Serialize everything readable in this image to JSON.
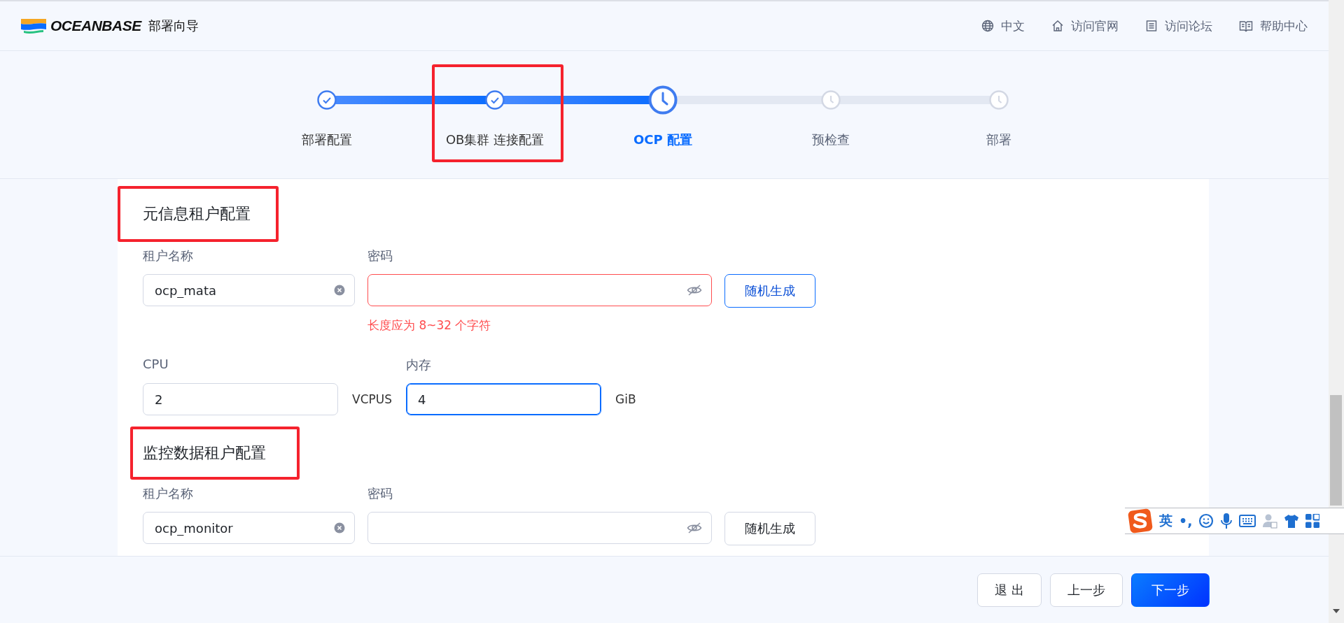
{
  "header": {
    "logo": "OCEANBASE",
    "title": "部署向导",
    "links": [
      {
        "label": "中文"
      },
      {
        "label": "访问官网"
      },
      {
        "label": "访问论坛"
      },
      {
        "label": "帮助中心"
      }
    ]
  },
  "steps": [
    {
      "label": "部署配置",
      "completed": true,
      "active": false,
      "highlighted": false
    },
    {
      "label": "OB集群 连接配置",
      "completed": true,
      "active": false,
      "highlighted": true
    },
    {
      "label": "OCP 配置",
      "completed": false,
      "active": true,
      "highlighted": false
    },
    {
      "label": "预检查",
      "completed": false,
      "active": false,
      "highlighted": false
    },
    {
      "label": "部署",
      "completed": false,
      "active": false,
      "highlighted": false
    }
  ],
  "sections": [
    {
      "title": "元信息租户配置",
      "highlighted": true,
      "name_label": "租户名称",
      "name_value": "ocp_mata",
      "password_label": "密码",
      "password_error": true,
      "error_message": "长度应为 8~32 个字符",
      "generate_button": {
        "label": "随机生成",
        "focused": true
      },
      "resources": {
        "cpu_label": "CPU",
        "cpu_value": "2",
        "cpu_unit": "VCPUS",
        "memory_label": "内存",
        "memory_value": "4",
        "memory_unit": "GiB",
        "memory_focused": true
      }
    },
    {
      "title": "监控数据租户配置",
      "highlighted": true,
      "name_label": "租户名称",
      "name_value": "ocp_monitor",
      "password_label": "密码",
      "password_error": false,
      "generate_button": {
        "label": "随机生成",
        "focused": false
      }
    }
  ],
  "footer": {
    "buttons": [
      {
        "label": "退 出",
        "kind": "default"
      },
      {
        "label": "上一步",
        "kind": "default"
      },
      {
        "label": "下一步",
        "kind": "primary"
      }
    ]
  },
  "ime": {
    "mode": "英",
    "punctuation": "•,"
  }
}
